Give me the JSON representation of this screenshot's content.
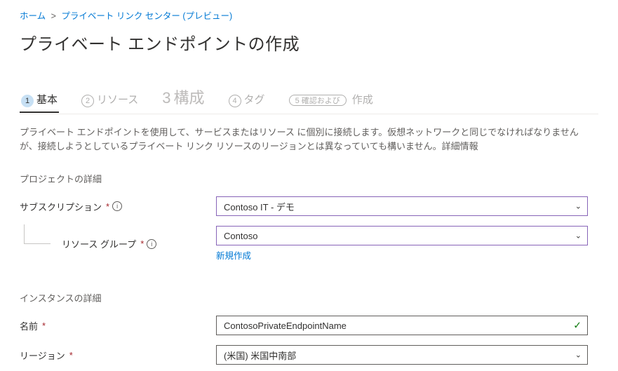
{
  "breadcrumb": {
    "home": "ホーム",
    "center": "プライベート リンク センター (プレビュー)"
  },
  "title": "プライベート エンドポイントの作成",
  "tabs": {
    "t1": {
      "num": "1",
      "label": "基本"
    },
    "t2": {
      "num": "2",
      "label": "リソース"
    },
    "t3": {
      "num": "3",
      "label": "構成"
    },
    "t4": {
      "num": "4",
      "label": "タグ"
    },
    "t5": {
      "badge": "5 確認および",
      "label": "作成"
    }
  },
  "description": "プライベート エンドポイントを使用して、サービスまたはリソース に個別に接続します。仮想ネットワークと同じでなければなりませんが、接続しようとしているプライベート リンク リソースのリージョンとは異なっていても構いません。詳細情報",
  "sections": {
    "project": "プロジェクトの詳細",
    "instance": "インスタンスの詳細"
  },
  "fields": {
    "subscription": {
      "label": "サブスクリプション",
      "value": "Contoso IT -   デモ"
    },
    "resourceGroup": {
      "label": "リソース グループ",
      "value": "Contoso",
      "newLink": "新規作成"
    },
    "name": {
      "label": "名前",
      "value": "ContosoPrivateEndpointName"
    },
    "region": {
      "label": "リージョン",
      "value": "(米国) 米国中南部"
    }
  },
  "requiredMark": "*"
}
